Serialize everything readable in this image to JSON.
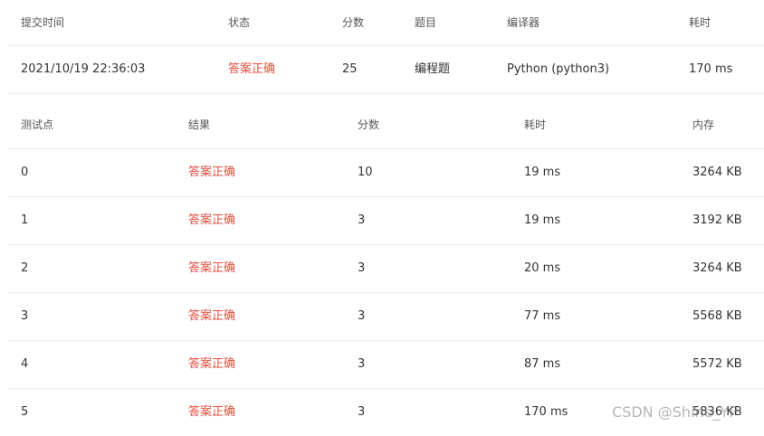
{
  "submission": {
    "headers": [
      "提交时间",
      "状态",
      "分数",
      "题目",
      "编译器",
      "耗时"
    ],
    "row": {
      "time": "2021/10/19 22:36:03",
      "status": "答案正确",
      "score": "25",
      "problem": "编程题",
      "compiler": "Python (python3)",
      "elapsed": "170 ms"
    }
  },
  "testcases": {
    "headers": [
      "测试点",
      "结果",
      "分数",
      "耗时",
      "内存"
    ],
    "rows": [
      {
        "id": "0",
        "result": "答案正确",
        "score": "10",
        "time": "19 ms",
        "memory": "3264 KB"
      },
      {
        "id": "1",
        "result": "答案正确",
        "score": "3",
        "time": "19 ms",
        "memory": "3192 KB"
      },
      {
        "id": "2",
        "result": "答案正确",
        "score": "3",
        "time": "20 ms",
        "memory": "3264 KB"
      },
      {
        "id": "3",
        "result": "答案正确",
        "score": "3",
        "time": "77 ms",
        "memory": "5568 KB"
      },
      {
        "id": "4",
        "result": "答案正确",
        "score": "3",
        "time": "87 ms",
        "memory": "5572 KB"
      },
      {
        "id": "5",
        "result": "答案正确",
        "score": "3",
        "time": "170 ms",
        "memory": "5836 KB"
      }
    ]
  },
  "colors": {
    "accepted": "#e74c3c",
    "divider": "#ececec"
  },
  "watermark": "CSDN @Shine_YP"
}
